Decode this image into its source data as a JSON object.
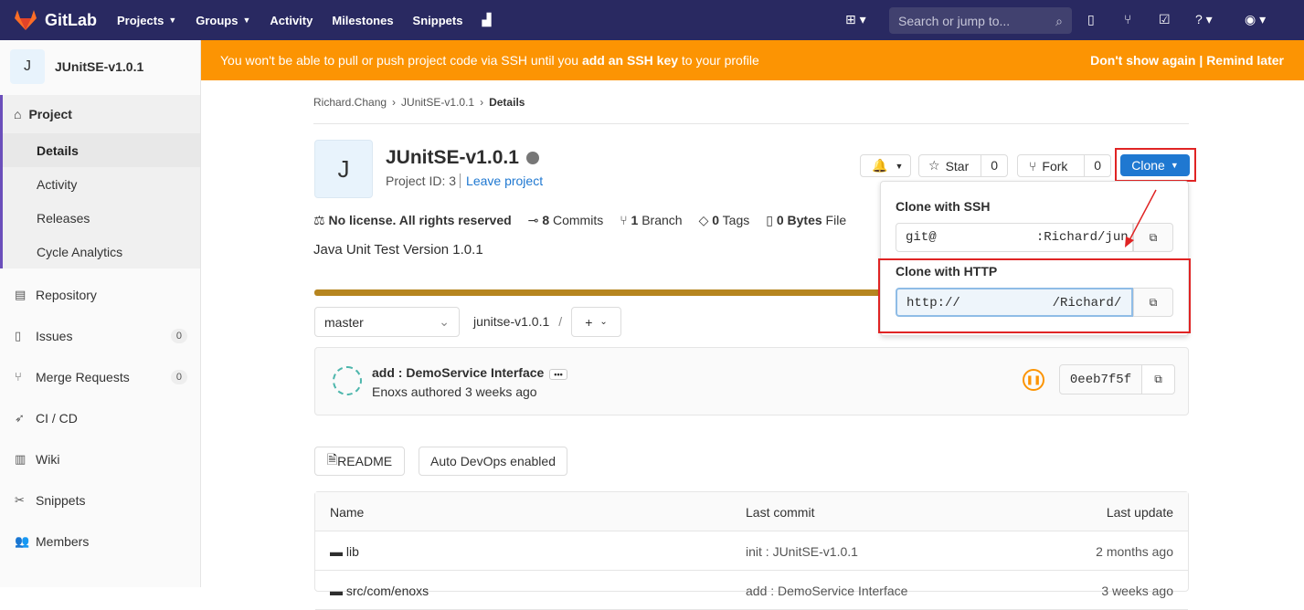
{
  "topbar": {
    "brand": "GitLab",
    "nav": [
      "Projects",
      "Groups",
      "Activity",
      "Milestones",
      "Snippets"
    ],
    "search_placeholder": "Search or jump to..."
  },
  "sidebar": {
    "project_letter": "J",
    "project_name": "JUnitSE-v1.0.1",
    "section": "Project",
    "sub_items": [
      "Details",
      "Activity",
      "Releases",
      "Cycle Analytics"
    ],
    "items": [
      {
        "label": "Repository",
        "count": ""
      },
      {
        "label": "Issues",
        "count": "0"
      },
      {
        "label": "Merge Requests",
        "count": "0"
      },
      {
        "label": "CI / CD",
        "count": ""
      },
      {
        "label": "Wiki",
        "count": ""
      },
      {
        "label": "Snippets",
        "count": ""
      },
      {
        "label": "Members",
        "count": ""
      }
    ]
  },
  "banner": {
    "text_pre": "You won't be able to pull or push project code via SSH until you ",
    "text_link": "add an SSH key",
    "text_post": " to your profile",
    "dont_show": "Don't show again",
    "sep": " | ",
    "remind": "Remind later"
  },
  "breadcrumb": [
    "Richard.Chang",
    "JUnitSE-v1.0.1",
    "Details"
  ],
  "project": {
    "letter": "J",
    "title": "JUnitSE-v1.0.1",
    "id_text": "Project ID: 3",
    "leave": "Leave project",
    "star": "Star",
    "star_count": "0",
    "fork": "Fork",
    "fork_count": "0",
    "clone": "Clone"
  },
  "stats": {
    "license": "No license. All rights reserved",
    "commits_n": "8",
    "commits": "Commits",
    "branch_n": "1",
    "branch": "Branch",
    "tags_n": "0",
    "tags": "Tags",
    "bytes_n": "0 Bytes",
    "bytes": "File"
  },
  "description": "Java Unit Test Version 1.0.1",
  "repo": {
    "branch": "master",
    "path": "junitse-v1.0.1",
    "path_sep": "/"
  },
  "commit": {
    "title": "add : DemoService Interface",
    "author": "Enoxs authored 3 weeks ago",
    "sha": "0eeb7f5f"
  },
  "buttons": {
    "readme": "README",
    "devops": "Auto DevOps enabled"
  },
  "table": {
    "headers": [
      "Name",
      "Last commit",
      "Last update"
    ],
    "rows": [
      [
        "lib",
        "init : JUnitSE-v1.0.1",
        "2 months ago"
      ],
      [
        "src/com/enoxs",
        "add : DemoService Interface",
        "3 weeks ago"
      ]
    ]
  },
  "clone_dropdown": {
    "ssh_title": "Clone with SSH",
    "ssh_value": "git@             :Richard/jun",
    "http_title": "Clone with HTTP",
    "http_value": "http://            /Richard/"
  },
  "colors": {
    "topbar": "#292961",
    "banner": "#fc9403",
    "accent": "#1f78d1",
    "annotation": "#e02424"
  }
}
